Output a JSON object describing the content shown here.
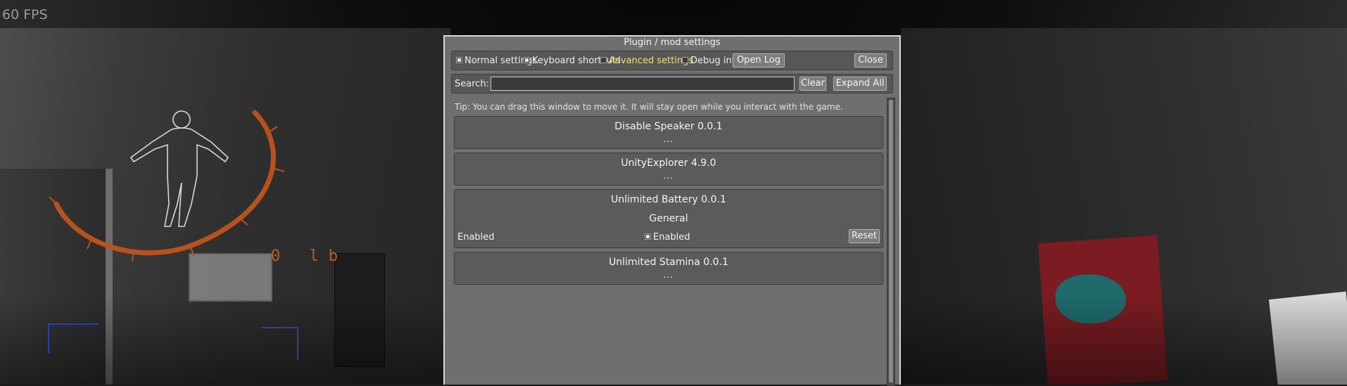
{
  "hud": {
    "fps": "60 FPS",
    "weight": "0 lb",
    "accent_color": "#c25a22"
  },
  "window": {
    "title": "Plugin / mod settings",
    "options": [
      {
        "label": "Normal settings",
        "checked": true
      },
      {
        "label": "Keyboard shortcuts",
        "checked": true
      },
      {
        "label": "Advanced settings",
        "checked": false
      },
      {
        "label": "Debug info",
        "checked": false
      }
    ],
    "open_log": "Open Log",
    "close": "Close",
    "search_label": "Search:",
    "search_value": "",
    "clear": "Clear",
    "expand_all": "Expand All",
    "tip": "Tip: You can drag this window to move it. It will stay open while you interact with the game.",
    "plugins": [
      {
        "name": "Disable Speaker 0.0.1",
        "more": "..."
      },
      {
        "name": "UnityExplorer 4.9.0",
        "more": "..."
      },
      {
        "name": "Unlimited Battery 0.0.1",
        "section": "General",
        "setting": {
          "label": "Enabled",
          "value": "Enabled",
          "checked": true,
          "reset": "Reset"
        }
      },
      {
        "name": "Unlimited Stamina 0.0.1",
        "more": "..."
      }
    ]
  }
}
